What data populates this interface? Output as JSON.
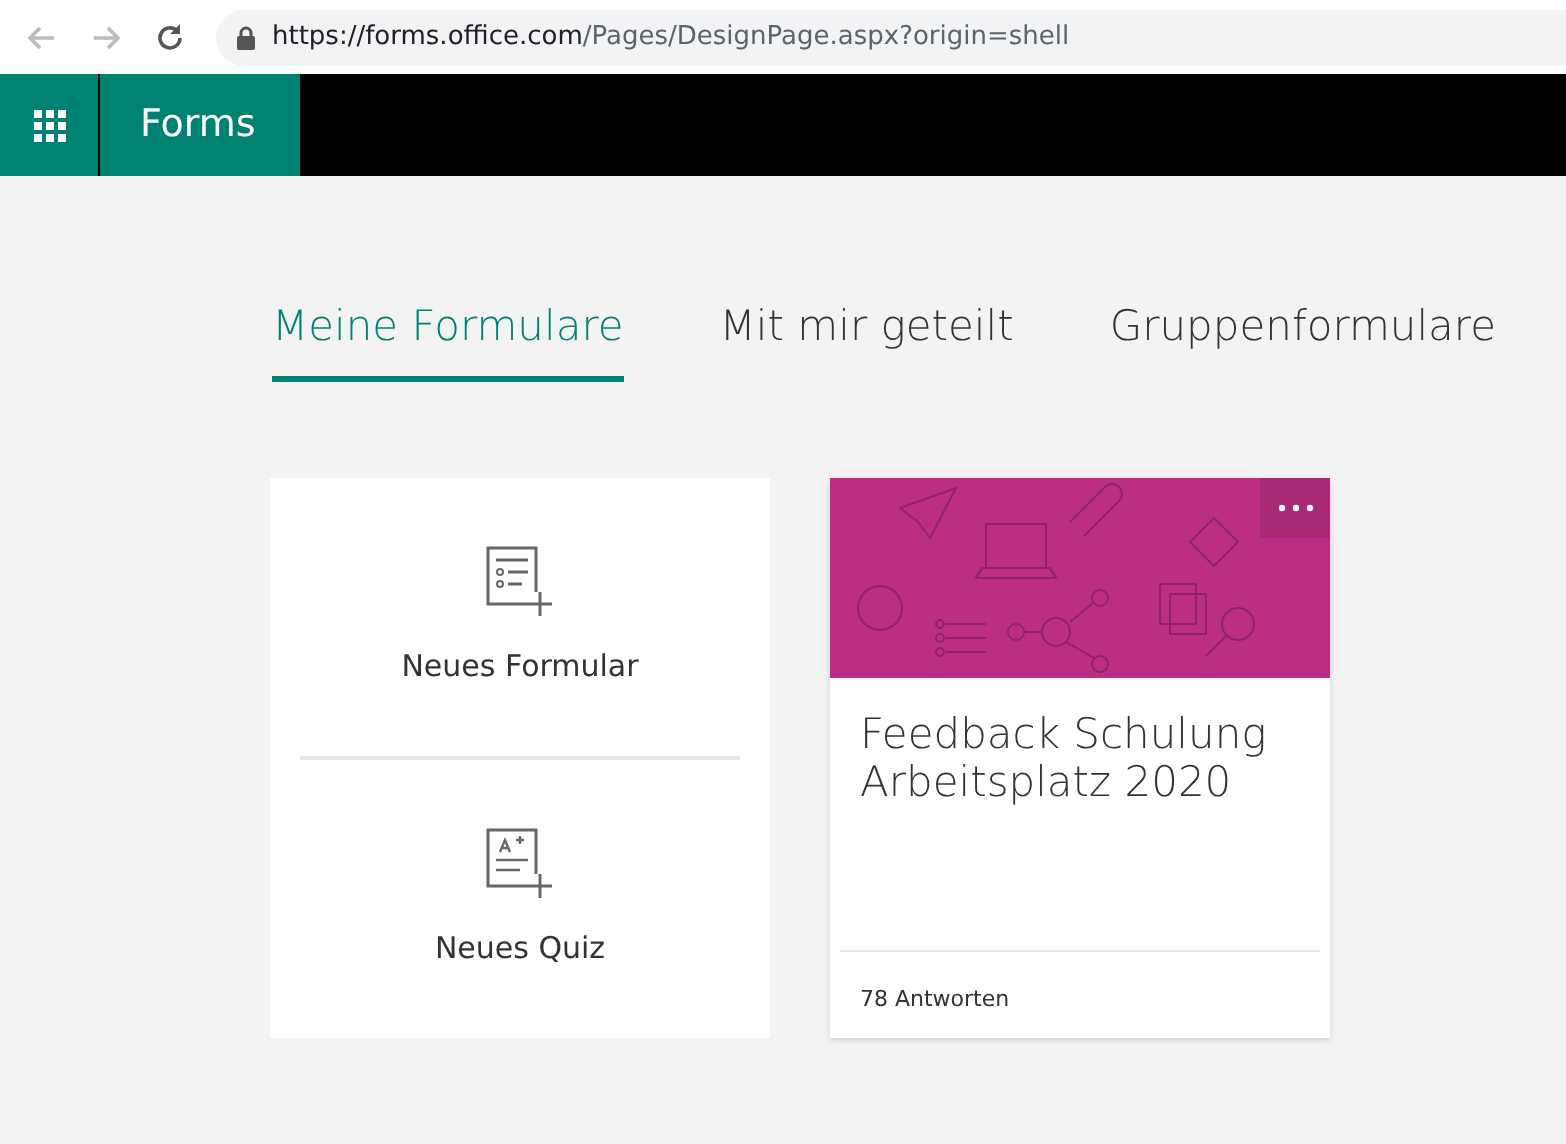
{
  "browser": {
    "url_host": "https://forms.office.com",
    "url_path": "/Pages/DesignPage.aspx?origin=shell"
  },
  "app": {
    "title": "Forms"
  },
  "tabs": [
    {
      "label": "Meine Formulare",
      "selected": true
    },
    {
      "label": "Mit mir geteilt",
      "selected": false
    },
    {
      "label": "Gruppenformulare",
      "selected": false
    }
  ],
  "create_items": [
    {
      "label": "Neues Formular",
      "kind": "form"
    },
    {
      "label": "Neues Quiz",
      "kind": "quiz"
    }
  ],
  "forms": [
    {
      "title": "Feedback Schulung Arbeitsplatz 2020",
      "responses": "78 Antworten"
    }
  ]
}
